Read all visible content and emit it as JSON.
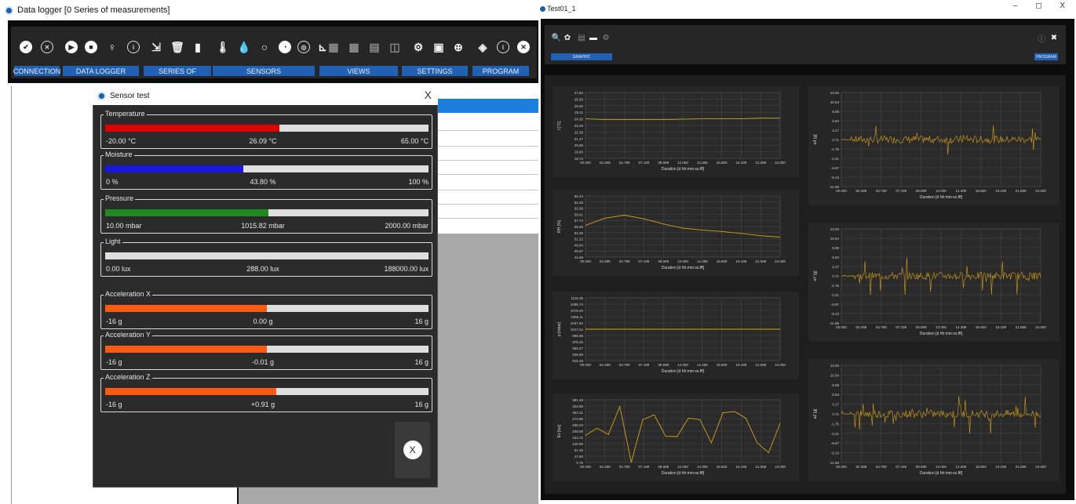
{
  "left_window": {
    "title": "Data logger [0 Series of measurements]",
    "sections": [
      {
        "label": "CONNECTION"
      },
      {
        "label": "DATA LOGGER"
      },
      {
        "label": "SERIES OF"
      },
      {
        "label": "SENSORS"
      },
      {
        "label": "VIEWS"
      },
      {
        "label": "SETTINGS"
      },
      {
        "label": "PROGRAM"
      }
    ],
    "toolbar_icons": [
      "check-icon",
      "disconnect-icon",
      "play-icon",
      "stop-icon",
      "lightbulb-icon",
      "info-icon",
      "export-icon",
      "trash-icon",
      "sdcard-icon",
      "thermometer-icon",
      "droplet-icon",
      "bulb-icon",
      "gauge-icon",
      "axes-icon",
      "table-icon",
      "chart-icon",
      "list-icon",
      "graph-icon",
      "gear-icon",
      "calculator-icon",
      "globe-icon",
      "eraser-icon",
      "info2-icon",
      "close-icon"
    ]
  },
  "sensor_dialog": {
    "title": "Sensor test",
    "close_label": "X",
    "exit_label": "X",
    "sensors": [
      {
        "name": "Temperature",
        "min": "-20.00 °C",
        "value": "26.09 °C",
        "max": "65.00 °C",
        "fraction": 0.54,
        "color": "#e00000"
      },
      {
        "name": "Moisture",
        "min": "0 %",
        "value": "43.80 %",
        "max": "100 %",
        "fraction": 0.428,
        "color": "#1818e0"
      },
      {
        "name": "Pressure",
        "min": "10.00 mbar",
        "value": "1015.82 mbar",
        "max": "2000.00 mbar",
        "fraction": 0.505,
        "color": "#1f8a1f"
      },
      {
        "name": "Light",
        "min": "0.00 lux",
        "value": "288.00 lux",
        "max": "188000.00 lux",
        "fraction": 0.002,
        "color": "#e8e0a0"
      },
      {
        "name": "Acceleration X",
        "min": "-16 g",
        "value": "0.00 g",
        "max": "16 g",
        "fraction": 0.5,
        "color": "#ff5a10"
      },
      {
        "name": "Acceleration Y",
        "min": "-16 g",
        "value": "-0.01 g",
        "max": "16 g",
        "fraction": 0.5,
        "color": "#ff5a10"
      },
      {
        "name": "Acceleration Z",
        "min": "-16 g",
        "value": "+0.91 g",
        "max": "16 g",
        "fraction": 0.528,
        "color": "#ff5a10"
      }
    ]
  },
  "right_window": {
    "title": "Test01_1",
    "window_controls": "– ◻ X",
    "graphic_label": "GRAPHIC",
    "program_label": "PROGRAM"
  },
  "chart_data": [
    {
      "type": "line",
      "ylabel": "t [°C]",
      "xlabel": "Duration [d hh:mm:ss.fff]",
      "x": [
        "00.000",
        "02.399",
        "04.799",
        "07.199",
        "09.599",
        "12.000",
        "14.399",
        "16.800",
        "19.199",
        "21.599",
        "24.000"
      ],
      "yticks": [
        "27.84",
        "26.93",
        "26.02",
        "25.11",
        "24.20",
        "23.29",
        "22.38",
        "21.47",
        "20.56",
        "19.65",
        "18.74"
      ],
      "ylim": [
        18.74,
        27.84
      ],
      "series": [
        {
          "values": [
            24.2,
            24.1,
            24.1,
            24.1,
            24.1,
            24.15,
            24.2,
            24.2,
            24.2,
            24.3,
            24.3
          ]
        }
      ],
      "color": "#d4a017"
    },
    {
      "type": "line",
      "ylabel": "RH [%]",
      "xlabel": "Duration [d hh:mm:ss.fff]",
      "x": [
        "00.000",
        "02.399",
        "04.799",
        "07.199",
        "09.599",
        "12.000",
        "14.399",
        "16.800",
        "19.199",
        "21.599",
        "24.000"
      ],
      "yticks": [
        "66.43",
        "64.28",
        "62.09",
        "59.91",
        "57.74",
        "55.56",
        "53.38",
        "51.22",
        "49.04",
        "46.87",
        "44.69"
      ],
      "ylim": [
        44.69,
        66.43
      ],
      "series": [
        {
          "values": [
            56.0,
            58.5,
            59.6,
            58.3,
            56.5,
            55.0,
            54.3,
            53.8,
            53.1,
            52.3,
            51.8
          ]
        }
      ],
      "color": "#d4a017"
    },
    {
      "type": "line",
      "ylabel": "p [mbar]",
      "xlabel": "Duration [d hh:mm:ss.fff]",
      "x": [
        "00.000",
        "02.399",
        "04.799",
        "07.199",
        "09.599",
        "12.000",
        "14.399",
        "16.800",
        "19.199",
        "21.599",
        "24.000"
      ],
      "yticks": [
        "1116.35",
        "1096.74",
        "1076.40",
        "1056.11",
        "1037.82",
        "1017.24",
        "996.65",
        "976.45",
        "956.07",
        "935.69",
        "915.29"
      ],
      "ylim": [
        915.29,
        1116.35
      ],
      "series": [
        {
          "values": [
            1015.8,
            1015.8,
            1015.8,
            1015.8,
            1015.8,
            1015.8,
            1015.8,
            1015.8,
            1015.8,
            1015.8,
            1015.8
          ]
        }
      ],
      "color": "#d4a017"
    },
    {
      "type": "line",
      "ylabel": "Ev [lux]",
      "xlabel": "Duration [d hh:mm:ss.fff]",
      "x": [
        "00.000",
        "02.399",
        "04.799",
        "07.199",
        "09.599",
        "12.000",
        "14.399",
        "16.800",
        "19.199",
        "21.599",
        "24.000"
      ],
      "yticks": [
        "381.28",
        "332.86",
        "304.31",
        "274.86",
        "238.23",
        "209.00",
        "164.72",
        "120.00",
        "91.25",
        "47.60",
        "0.75"
      ],
      "ylim": [
        0.75,
        381.28
      ],
      "series": [
        {
          "values": [
            164.7,
            209.0,
            170.5,
            340.1,
            0.75,
            260.2,
            290.0,
            160.0,
            158.4,
            270.0,
            260.0,
            120.0,
            302.5,
            310.0,
            270.2,
            120.0,
            60.0,
            240.1
          ]
        }
      ],
      "color": "#d4a017"
    },
    {
      "type": "line",
      "ylabel": "aX [g]",
      "xlabel": "Duration [d hh:mm:ss.fff]",
      "x": [
        "00.000",
        "02.399",
        "04.799",
        "07.199",
        "09.599",
        "12.000",
        "14.399",
        "16.800",
        "19.199",
        "21.599",
        "24.000"
      ],
      "yticks": [
        "13.00",
        "10.54",
        "8.09",
        "5.63",
        "3.17",
        "0.71",
        "-1.75",
        "-4.21",
        "-6.67",
        "-9.13",
        "-11.58"
      ],
      "ylim": [
        -11.58,
        13.0
      ],
      "series": [
        {
          "values": []
        }
      ],
      "color": "#d4a017"
    },
    {
      "type": "line",
      "ylabel": "aY [g]",
      "xlabel": "Duration [d hh:mm:ss.fff]",
      "x": [
        "00.000",
        "02.399",
        "04.799",
        "07.199",
        "09.599",
        "12.000",
        "14.399",
        "16.800",
        "19.199",
        "21.599",
        "24.000"
      ],
      "yticks": [
        "13.00",
        "10.54",
        "8.09",
        "5.63",
        "3.17",
        "0.71",
        "-1.75",
        "-4.21",
        "-6.67",
        "-9.13",
        "-11.58"
      ],
      "ylim": [
        -11.58,
        13.0
      ],
      "series": [
        {
          "values": []
        }
      ],
      "color": "#d4a017"
    },
    {
      "type": "line",
      "ylabel": "aZ [g]",
      "xlabel": "Duration [d hh:mm:ss.fff]",
      "x": [
        "00.000",
        "02.399",
        "04.799",
        "07.199",
        "09.599",
        "12.000",
        "14.399",
        "16.800",
        "19.199",
        "21.599",
        "24.000"
      ],
      "yticks": [
        "13.00",
        "10.54",
        "8.09",
        "5.63",
        "3.17",
        "0.71",
        "-1.75",
        "-4.21",
        "-6.67",
        "-9.13",
        "-11.58"
      ],
      "ylim": [
        -11.58,
        13.0
      ],
      "series": [
        {
          "values": []
        }
      ],
      "color": "#d4a017"
    }
  ]
}
